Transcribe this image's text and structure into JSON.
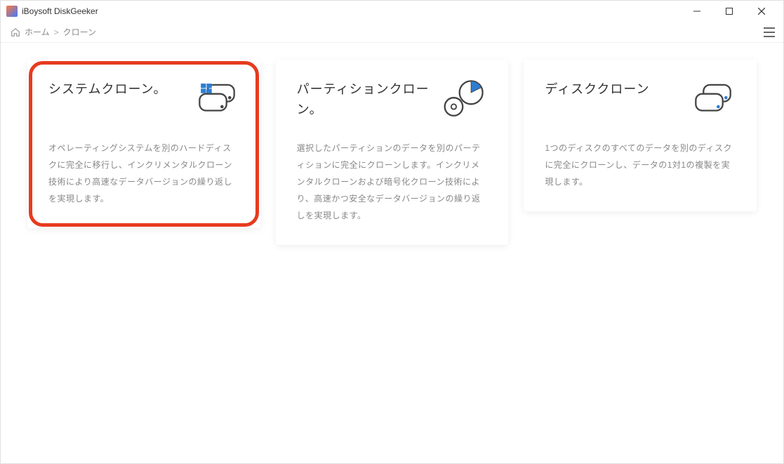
{
  "window": {
    "title": "iBoysoft DiskGeeker"
  },
  "breadcrumb": {
    "home": "ホーム",
    "sep": ">",
    "current": "クローン"
  },
  "cards": [
    {
      "title": "システムクローン。",
      "desc": "オペレーティングシステムを別のハードディスクに完全に移行し、インクリメンタルクローン技術により高速なデータバージョンの繰り返しを実現します。"
    },
    {
      "title": "パーティションクローン。",
      "desc": "選択したパーティションのデータを別のパーティションに完全にクローンします。インクリメンタルクローンおよび暗号化クローン技術により、高速かつ安全なデータバージョンの繰り返しを実現します。"
    },
    {
      "title": "ディスククローン",
      "desc": "1つのディスクのすべてのデータを別のディスクに完全にクローンし、データの1対1の複製を実現します。"
    }
  ]
}
